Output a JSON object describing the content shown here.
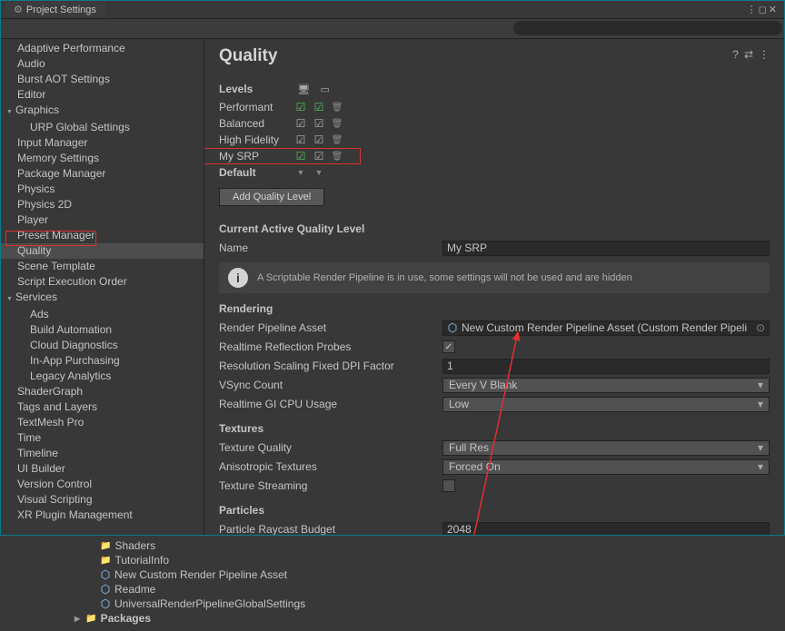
{
  "titlebar": {
    "title": "Project Settings"
  },
  "search": {
    "placeholder": ""
  },
  "sidebar": {
    "items": [
      {
        "label": "Adaptive Performance",
        "type": "normal"
      },
      {
        "label": "Audio",
        "type": "normal"
      },
      {
        "label": "Burst AOT Settings",
        "type": "normal"
      },
      {
        "label": "Editor",
        "type": "normal"
      },
      {
        "label": "Graphics",
        "type": "expandable"
      },
      {
        "label": "URP Global Settings",
        "type": "child"
      },
      {
        "label": "Input Manager",
        "type": "normal"
      },
      {
        "label": "Memory Settings",
        "type": "normal"
      },
      {
        "label": "Package Manager",
        "type": "normal"
      },
      {
        "label": "Physics",
        "type": "normal"
      },
      {
        "label": "Physics 2D",
        "type": "normal"
      },
      {
        "label": "Player",
        "type": "normal"
      },
      {
        "label": "Preset Manager",
        "type": "normal"
      },
      {
        "label": "Quality",
        "type": "normal",
        "selected": true
      },
      {
        "label": "Scene Template",
        "type": "normal"
      },
      {
        "label": "Script Execution Order",
        "type": "normal"
      },
      {
        "label": "Services",
        "type": "expandable"
      },
      {
        "label": "Ads",
        "type": "child"
      },
      {
        "label": "Build Automation",
        "type": "child"
      },
      {
        "label": "Cloud Diagnostics",
        "type": "child"
      },
      {
        "label": "In-App Purchasing",
        "type": "child"
      },
      {
        "label": "Legacy Analytics",
        "type": "child"
      },
      {
        "label": "ShaderGraph",
        "type": "normal"
      },
      {
        "label": "Tags and Layers",
        "type": "normal"
      },
      {
        "label": "TextMesh Pro",
        "type": "normal"
      },
      {
        "label": "Time",
        "type": "normal"
      },
      {
        "label": "Timeline",
        "type": "normal"
      },
      {
        "label": "UI Builder",
        "type": "normal"
      },
      {
        "label": "Version Control",
        "type": "normal"
      },
      {
        "label": "Visual Scripting",
        "type": "normal"
      },
      {
        "label": "XR Plugin Management",
        "type": "normal"
      }
    ]
  },
  "content": {
    "title": "Quality",
    "levels_title": "Levels",
    "levels": [
      {
        "name": "Performant",
        "c1": "green",
        "c2": "green"
      },
      {
        "name": "Balanced",
        "c1": "gray",
        "c2": "gray"
      },
      {
        "name": "High Fidelity",
        "c1": "gray",
        "c2": "gray"
      },
      {
        "name": "My SRP",
        "c1": "green",
        "c2": "gray"
      }
    ],
    "default_label": "Default",
    "add_quality_btn": "Add Quality Level",
    "active_level_title": "Current Active Quality Level",
    "name_label": "Name",
    "name_value": "My SRP",
    "info_text": "A Scriptable Render Pipeline is in use, some settings will not be used and are hidden",
    "rendering_title": "Rendering",
    "fields": {
      "render_pipeline_label": "Render Pipeline Asset",
      "render_pipeline_value": "New Custom Render Pipeline Asset (Custom Render Pipeli",
      "refl_probes_label": "Realtime Reflection Probes",
      "refl_probes_checked": true,
      "dpi_label": "Resolution Scaling Fixed DPI Factor",
      "dpi_value": "1",
      "vsync_label": "VSync Count",
      "vsync_value": "Every V Blank",
      "gi_label": "Realtime GI CPU Usage",
      "gi_value": "Low"
    },
    "textures_title": "Textures",
    "texture_fields": {
      "quality_label": "Texture Quality",
      "quality_value": "Full Res",
      "aniso_label": "Anisotropic Textures",
      "aniso_value": "Forced On",
      "streaming_label": "Texture Streaming"
    },
    "particles_title": "Particles",
    "particles": {
      "budget_label": "Particle Raycast Budget",
      "budget_value": "2048"
    }
  },
  "project": {
    "items": [
      {
        "label": "Shaders",
        "icon": "folder",
        "indent": 2
      },
      {
        "label": "TutorialInfo",
        "icon": "folder",
        "indent": 2
      },
      {
        "label": "New Custom Render Pipeline Asset",
        "icon": "asset",
        "indent": 2
      },
      {
        "label": "Readme",
        "icon": "asset",
        "indent": 2
      },
      {
        "label": "UniversalRenderPipelineGlobalSettings",
        "icon": "asset",
        "indent": 2
      },
      {
        "label": "Packages",
        "icon": "folder",
        "indent": 0,
        "bold": true,
        "expandable": true
      }
    ]
  }
}
